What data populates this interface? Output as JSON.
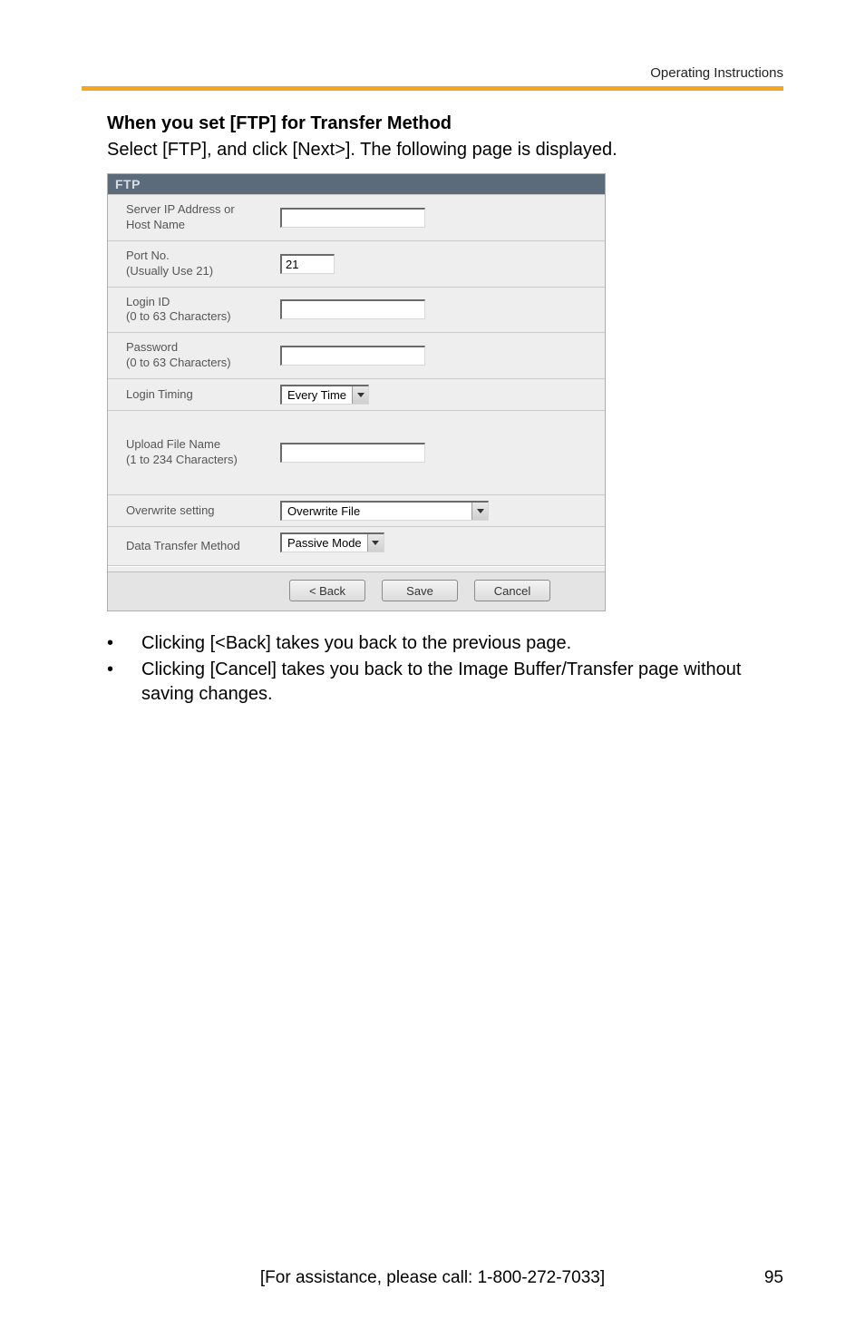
{
  "header": {
    "doc_title": "Operating Instructions"
  },
  "section": {
    "heading": "When you set [FTP] for Transfer Method",
    "sub": "Select [FTP], and click [Next>]. The following page is displayed."
  },
  "ftp": {
    "title": "FTP",
    "labels": {
      "server": "Server IP Address or Host Name",
      "port": "Port No.\n(Usually Use 21)",
      "login": "Login ID\n(0 to 63 Characters)",
      "password": "Password\n(0 to 63 Characters)",
      "timing": "Login Timing",
      "upload": "Upload File Name\n(1 to 234 Characters)",
      "overwrite": "Overwrite setting",
      "transfer": "Data Transfer Method"
    },
    "values": {
      "server": "",
      "port": "21",
      "login": "",
      "password": "",
      "timing": "Every Time",
      "upload": "",
      "overwrite": "Overwrite File",
      "transfer": "Passive Mode"
    },
    "buttons": {
      "back": "< Back",
      "save": "Save",
      "cancel": "Cancel"
    }
  },
  "bullets": {
    "b1": "Clicking [<Back] takes you back to the previous page.",
    "b2": "Clicking [Cancel] takes you back to the Image Buffer/Transfer page without saving changes."
  },
  "footer": {
    "assist": "[For assistance, please call: 1-800-272-7033]",
    "page": "95"
  }
}
